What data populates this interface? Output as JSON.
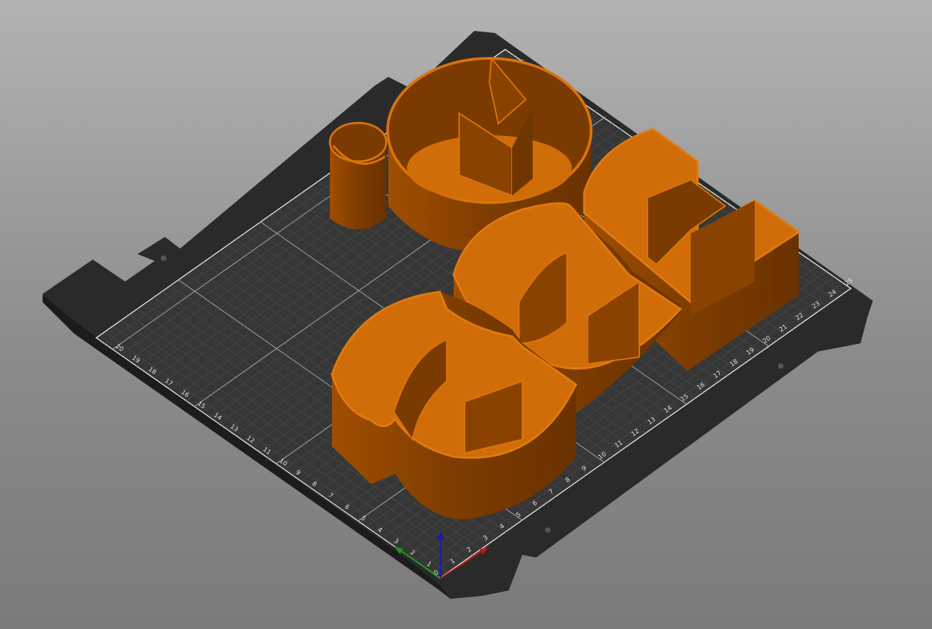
{
  "viewport": {
    "background_top": "#b3b3b3",
    "background_bottom": "#7a7a7a"
  },
  "bed": {
    "plate_color": "#2c2c2c",
    "grid_color": "#5a5a5a",
    "edge_color": "#e8e8e8",
    "x_ticks": [
      "0",
      "1",
      "2",
      "3",
      "4",
      "5",
      "6",
      "7",
      "8",
      "9",
      "10",
      "11",
      "12",
      "13",
      "14",
      "15",
      "16",
      "17",
      "18",
      "19",
      "20",
      "21",
      "22",
      "23",
      "24",
      "25"
    ],
    "y_ticks": [
      "1",
      "2",
      "3",
      "4",
      "5",
      "6",
      "7",
      "8",
      "9",
      "10",
      "11",
      "12",
      "13",
      "14",
      "15",
      "16",
      "17",
      "18",
      "19",
      "20"
    ]
  },
  "model": {
    "color": "#d9740a",
    "shade_color": "#8a4200",
    "inner_color": "#6f3600"
  },
  "axes": {
    "x_color": "#c01818",
    "y_color": "#1a9a1a",
    "z_color": "#1a1ab0"
  }
}
